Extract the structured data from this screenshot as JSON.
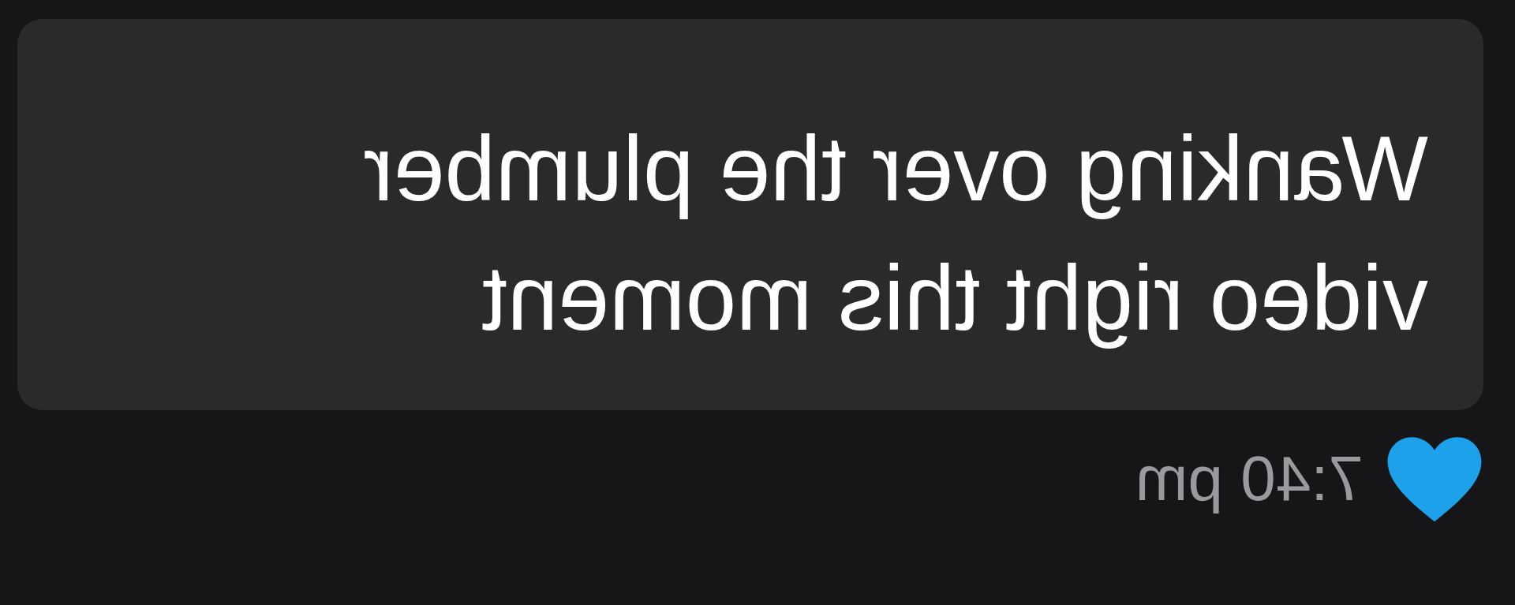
{
  "message": {
    "text": "Wanking over the plumber video right this moment",
    "liked": true,
    "time": "7:40 pm"
  }
}
